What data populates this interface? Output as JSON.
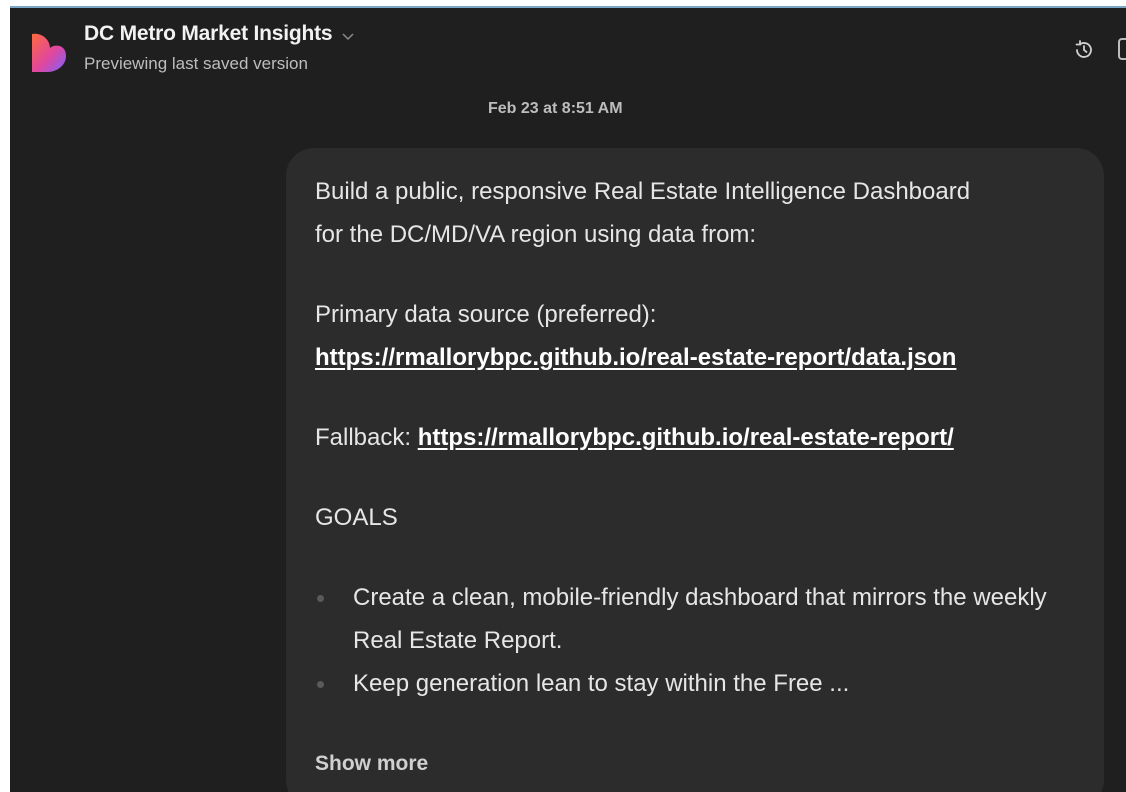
{
  "header": {
    "title": "DC Metro Market Insights",
    "subtitle": "Previewing last saved version",
    "logo_icon": "heart-logo-icon",
    "title_chevron_icon": "chevron-down-icon",
    "history_icon": "history-clock-icon",
    "brand_gradient": [
      "#ff6a3d",
      "#e0479e",
      "#7b61ff"
    ]
  },
  "conversation": {
    "timestamp": "Feb 23 at 8:51 AM",
    "message": {
      "intro_line1": "Build a public, responsive Real Estate Intelligence Dashboard",
      "intro_line2": "for the DC/MD/VA region using data from:",
      "primary_label": "Primary data source (preferred):",
      "primary_link": "https://rmallorybpc.github.io/real-estate-report/data.json",
      "fallback_label": "Fallback: ",
      "fallback_link": "https://rmallorybpc.github.io/real-estate-report/",
      "goals_heading": "GOALS",
      "goals": [
        "Create a clean, mobile-friendly dashboard that mirrors the weekly Real Estate Report.",
        "Keep generation lean to stay within the Free ..."
      ],
      "show_more": "Show more"
    }
  },
  "colors": {
    "background": "#1f1f1f",
    "bubble": "#2c2c2c",
    "text": "#e6e6e6",
    "muted": "#bdbdbd"
  }
}
